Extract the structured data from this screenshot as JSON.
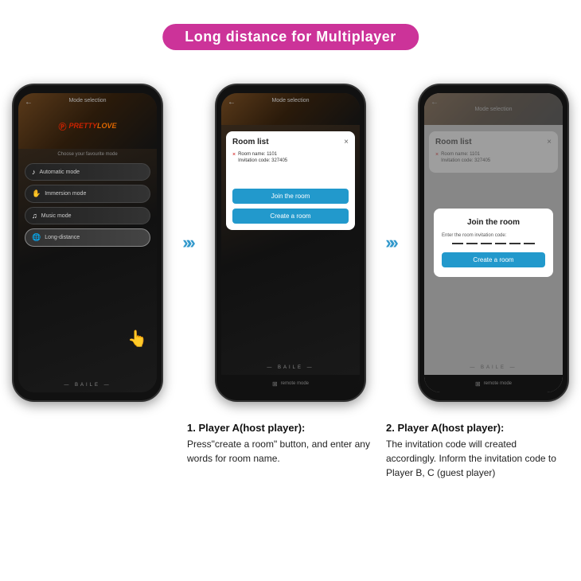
{
  "title": "Long distance for Multiplayer",
  "phones": [
    {
      "id": "phone1",
      "header": {
        "back": "←",
        "mode_selection": "Mode selection",
        "logo_prefix": "P",
        "logo_main": "PRETTY",
        "logo_suffix": "LOVE"
      },
      "choose_text": "Choose your favourite mode",
      "modes": [
        {
          "icon": "♪",
          "label": "Automatic mode"
        },
        {
          "icon": "✋",
          "label": "Immersion mode"
        },
        {
          "icon": "♫",
          "label": "Music mode"
        },
        {
          "icon": "🌐",
          "label": "Long-distance",
          "highlighted": true
        }
      ],
      "footer": "— BAILE —"
    },
    {
      "id": "phone2",
      "header": {
        "back": "←",
        "mode_selection": "Mode selection"
      },
      "modal": {
        "title": "Room list",
        "close": "×",
        "room": {
          "name_label": "Room name: 1101",
          "code_label": "Invitation code: 327405"
        },
        "join_btn": "Join the room",
        "create_btn": "Create a room"
      },
      "footer": {
        "icon": "⊞",
        "label": "remote mode"
      },
      "baile": "— BAILE —"
    },
    {
      "id": "phone3",
      "header": {
        "back": "←",
        "mode_selection": "Mode selection"
      },
      "room_list": {
        "title": "Room list",
        "close": "×",
        "room": {
          "name_label": "Room name: 1101",
          "code_label": "Invitation code: 327405"
        }
      },
      "join_modal": {
        "title": "Join the room",
        "label": "Enter the room invitation code:",
        "create_btn": "Create a room"
      },
      "footer": {
        "icon": "⊞",
        "label": "remote mode"
      },
      "baile": "— BAILE —"
    }
  ],
  "arrows": [
    {
      "id": "arrow1"
    },
    {
      "id": "arrow2"
    }
  ],
  "descriptions": [
    {
      "number": "1.",
      "title": "Player A(host player):",
      "text": "Press\"create a room\" button, and enter any words for room name."
    },
    {
      "number": "2.",
      "title": "Player A(host player):",
      "text": "The invitation code will created accordingly. Inform the invitation code to Player B, C (guest player)"
    }
  ]
}
